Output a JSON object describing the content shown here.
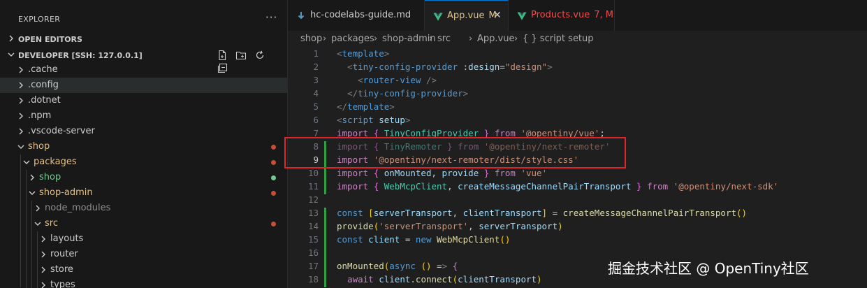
{
  "explorer": {
    "title": "EXPLORER",
    "more": "···",
    "open_editors": "OPEN EDITORS",
    "workspace": "DEVELOPER [SSH: 127.0.0.1]",
    "tree": [
      {
        "label": ".cache",
        "depth": 0,
        "expanded": false,
        "color": "#cccccc",
        "dot": null,
        "selected": false
      },
      {
        "label": ".config",
        "depth": 0,
        "expanded": false,
        "color": "#cccccc",
        "dot": null,
        "selected": true
      },
      {
        "label": ".dotnet",
        "depth": 0,
        "expanded": false,
        "color": "#cccccc",
        "dot": null,
        "selected": false
      },
      {
        "label": ".npm",
        "depth": 0,
        "expanded": false,
        "color": "#cccccc",
        "dot": null,
        "selected": false
      },
      {
        "label": ".vscode-server",
        "depth": 0,
        "expanded": false,
        "color": "#cccccc",
        "dot": null,
        "selected": false
      },
      {
        "label": "shop",
        "depth": 0,
        "expanded": true,
        "color": "#e2c08d",
        "dot": "#c74e39",
        "selected": false
      },
      {
        "label": "packages",
        "depth": 1,
        "expanded": true,
        "color": "#e2c08d",
        "dot": "#c74e39",
        "selected": false
      },
      {
        "label": "shop",
        "depth": 2,
        "expanded": false,
        "color": "#73c991",
        "dot": "#73c991",
        "selected": false
      },
      {
        "label": "shop-admin",
        "depth": 2,
        "expanded": true,
        "color": "#e2c08d",
        "dot": "#c74e39",
        "selected": false
      },
      {
        "label": "node_modules",
        "depth": 3,
        "expanded": false,
        "color": "#8c8c8c",
        "dot": null,
        "selected": false
      },
      {
        "label": "src",
        "depth": 3,
        "expanded": true,
        "color": "#e2c08d",
        "dot": "#c74e39",
        "selected": false
      },
      {
        "label": "layouts",
        "depth": 4,
        "expanded": false,
        "color": "#cccccc",
        "dot": null,
        "selected": false
      },
      {
        "label": "router",
        "depth": 4,
        "expanded": false,
        "color": "#cccccc",
        "dot": null,
        "selected": false
      },
      {
        "label": "store",
        "depth": 4,
        "expanded": false,
        "color": "#cccccc",
        "dot": null,
        "selected": false
      },
      {
        "label": "types",
        "depth": 4,
        "expanded": false,
        "color": "#cccccc",
        "dot": null,
        "selected": false
      }
    ]
  },
  "tabs": [
    {
      "name": "hc-codelabs-guide.md",
      "badge": "",
      "icon": "markdown-icon",
      "color": "#cccccc",
      "active": false
    },
    {
      "name": "App.vue",
      "badge": "M",
      "icon": "vue-icon",
      "color": "#e2c08d",
      "active": true
    },
    {
      "name": "Products.vue",
      "badge": "7, M",
      "icon": "vue-icon",
      "color": "#f14c4c",
      "active": false
    }
  ],
  "breadcrumb": [
    "shop",
    "packages",
    "shop-admin",
    "src",
    "App.vue",
    "{ } script setup"
  ],
  "code_lines": [
    {
      "n": "1",
      "text": "<template>"
    },
    {
      "n": "2",
      "text": "  <tiny-config-provider :design=\"design\">"
    },
    {
      "n": "3",
      "text": "    <router-view />"
    },
    {
      "n": "4",
      "text": "  </tiny-config-provider>"
    },
    {
      "n": "5",
      "text": "</template>"
    },
    {
      "n": "6",
      "text": "<script setup>"
    },
    {
      "n": "7",
      "text": "import { TinyConfigProvider } from '@opentiny/vue';"
    },
    {
      "n": "8",
      "text": "import { TinyRemoter } from '@opentiny/next-remoter'"
    },
    {
      "n": "9",
      "text": "import '@opentiny/next-remoter/dist/style.css'"
    },
    {
      "n": "10",
      "text": "import { onMounted, provide } from 'vue'"
    },
    {
      "n": "11",
      "text": "import { WebMcpClient, createMessageChannelPairTransport } from '@opentiny/next-sdk'"
    },
    {
      "n": "12",
      "text": ""
    },
    {
      "n": "13",
      "text": "const [serverTransport, clientTransport] = createMessageChannelPairTransport()"
    },
    {
      "n": "14",
      "text": "provide('serverTransport', serverTransport)"
    },
    {
      "n": "15",
      "text": "const client = new WebMcpClient()"
    },
    {
      "n": "16",
      "text": ""
    },
    {
      "n": "17",
      "text": "onMounted(async () => {"
    },
    {
      "n": "18",
      "text": "  await client.connect(clientTransport)"
    }
  ],
  "current_line": "9",
  "watermark": "掘金技术社区 @ OpenTiny社区"
}
